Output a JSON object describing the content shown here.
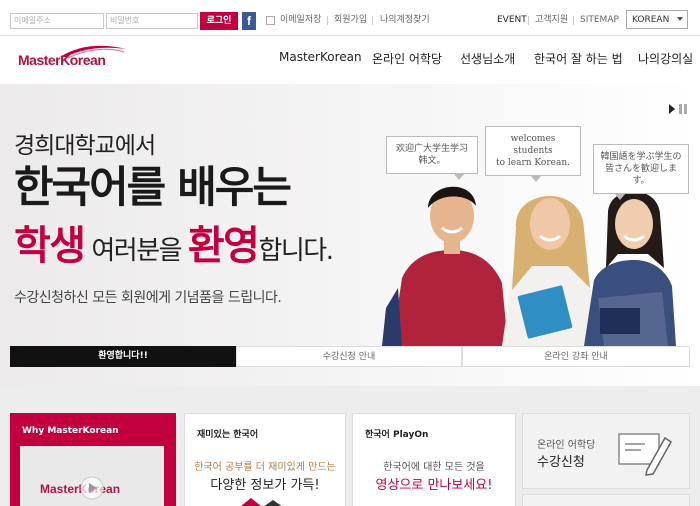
{
  "login": {
    "email_placeholder": "이메일주소",
    "password_placeholder": "비밀번호",
    "login_label": "로그인",
    "save_email_label": "이메일저장",
    "signup_label": "회원가입",
    "find_account_label": "나의계정찾기"
  },
  "utility": {
    "event_label": "EVENT",
    "support_label": "고객지원",
    "sitemap_label": "SITEMAP",
    "language_selected": "KOREAN"
  },
  "brand": {
    "logo_text": "MasterKorean",
    "accent_color": "#c3003f"
  },
  "nav": {
    "items": [
      "MasterKorean",
      "온라인 어학당",
      "선생님소개",
      "한국어 잘 하는 법",
      "나의강의실"
    ]
  },
  "hero": {
    "line1": "경희대학교에서",
    "line2": "한국어를 배우는",
    "line3_a": "학생",
    "line3_b": " 여러분을 ",
    "line3_c": "환영",
    "line3_d": "합니다.",
    "line4": "수강신청하신 모든 회원에게 기념품을 드립니다.",
    "bubbles": [
      [
        "欢迎广大学生学习",
        "韩文。"
      ],
      [
        "welcomes students",
        "to learn Korean."
      ],
      [
        "韓国語を学ぶ学生の",
        "皆さんを歓迎します。"
      ]
    ],
    "tabs": [
      "환영합니다!!",
      "수강신청 안내",
      "온라인 강좌 안내"
    ]
  },
  "cards": {
    "why_title": "Why MasterKorean",
    "fun_title": "재미있는 한국어",
    "fun_line1": "한국어 공부를 더 재미있게 만드는",
    "fun_line2": "다양한 정보가 가득!",
    "playon_title": "한국어 PlayOn",
    "playon_line1": "한국어에 대한 모든 것을",
    "playon_line2": "영상으로 만나보세요!",
    "enroll_sub": "온라인 어학당",
    "enroll_title": "수강신청"
  }
}
